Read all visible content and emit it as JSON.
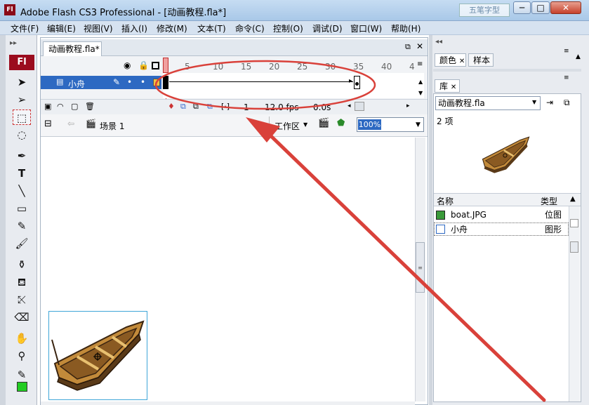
{
  "window": {
    "title": "Adobe Flash CS3 Professional - [动画教程.fla*]",
    "app_icon": "Fl",
    "watermark": "五笔字型",
    "min_label": "─",
    "max_label": "□",
    "close_label": "✕"
  },
  "menu": [
    "文件(F)",
    "编辑(E)",
    "视图(V)",
    "插入(I)",
    "修改(M)",
    "文本(T)",
    "命令(C)",
    "控制(O)",
    "调试(D)",
    "窗口(W)",
    "帮助(H)"
  ],
  "toolbox": {
    "logo": "Fl",
    "tools": [
      "selection-tool",
      "subselection-tool",
      "free-transform-tool",
      "lasso-tool",
      "pen-tool",
      "text-tool",
      "line-tool",
      "rectangle-tool",
      "pencil-tool",
      "brush-tool",
      "ink-bottle-tool",
      "paint-bucket-tool",
      "eyedropper-tool",
      "eraser-tool",
      "hand-tool",
      "zoom-tool",
      "stroke-color-tool",
      "fill-color-tool"
    ],
    "fill_color": "#22cc22"
  },
  "document": {
    "tab_label": "动画教程.fla*",
    "close_label": "✕"
  },
  "timeline": {
    "frame_numbers": [
      "5",
      "10",
      "15",
      "20",
      "25",
      "30",
      "35",
      "40",
      "4"
    ],
    "layer_name": "小舟",
    "current_frame": "1",
    "fps": "12.0 fps",
    "time": "0.0s",
    "tween_start": 1,
    "tween_end": 35,
    "highlight_color": "#d9413a",
    "layer_color": "#2d69c2"
  },
  "edit_bar": {
    "scene_label": "场景 1",
    "workspace_label": "工作区",
    "zoom": "100%"
  },
  "right_panel": {
    "color_tab": "颜色",
    "swatches_tab": "样本",
    "library_tab": "库",
    "library_file": "动画教程.fla",
    "item_count": "2 项",
    "col_name": "名称",
    "col_type": "类型",
    "items": [
      {
        "name": "boat.JPG",
        "type": "位图"
      },
      {
        "name": "小舟",
        "type": "图形"
      }
    ]
  }
}
